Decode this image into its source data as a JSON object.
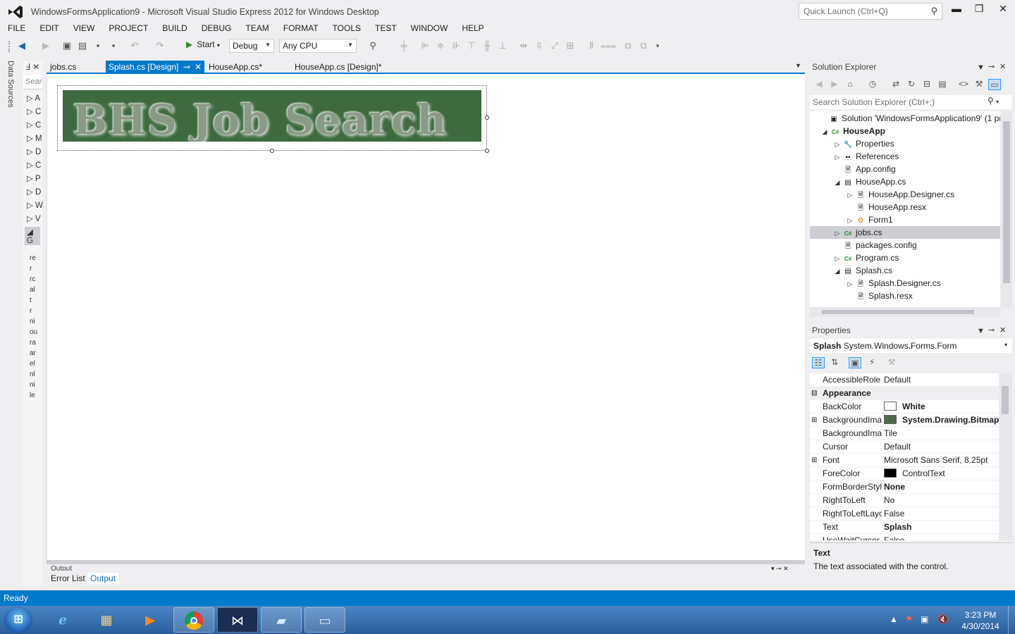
{
  "window": {
    "title": "WindowsFormsApplication9 - Microsoft Visual Studio Express 2012 for Windows Desktop",
    "quick_launch_placeholder": "Quick Launch (Ctrl+Q)",
    "minimize": "▬",
    "restore": "❐",
    "close": "✕"
  },
  "menu": [
    "FILE",
    "EDIT",
    "VIEW",
    "PROJECT",
    "BUILD",
    "DEBUG",
    "TEAM",
    "FORMAT",
    "TOOLS",
    "TEST",
    "WINDOW",
    "HELP"
  ],
  "toolbar": {
    "start_label": "Start",
    "config": "Debug",
    "platform": "Any CPU"
  },
  "left_panel": {
    "data_sources": "Data Sources",
    "toolbox_header": "Ⅎ",
    "toolbox_search": "Searc",
    "items": [
      "A",
      "C",
      "C",
      "M",
      "D",
      "C",
      "P",
      "D",
      "W",
      "V",
      "G"
    ],
    "fragments": [
      "re",
      "r",
      "rc",
      "al",
      "t",
      "r",
      "ni",
      "ou",
      "ra",
      "ar",
      "el",
      "nl",
      "ni",
      "le"
    ]
  },
  "tabs": [
    {
      "label": "jobs.cs"
    },
    {
      "label": "Splash.cs [Design]",
      "pin": "⊸",
      "close": "✕"
    },
    {
      "label": "HouseApp.cs*"
    },
    {
      "label": "HouseApp.cs [Design]*"
    }
  ],
  "designer": {
    "banner_text": "BHS Job Search",
    "banner_color": "#3e6a3f"
  },
  "output": {
    "title": "Output",
    "tabs": [
      "Error List",
      "Output"
    ]
  },
  "solution_explorer": {
    "title": "Solution Explorer",
    "search_placeholder": "Search Solution Explorer (Ctrl+;)",
    "nodes": [
      {
        "label": "Solution 'WindowsFormsApplication9' (1 pro",
        "expander": "",
        "icon": "▣"
      },
      {
        "label": "HouseApp",
        "expander": "◢",
        "icon": "C#",
        "bold": true
      },
      {
        "label": "Properties",
        "expander": "▷",
        "icon": "🔧"
      },
      {
        "label": "References",
        "expander": "▷",
        "icon": "▪▪"
      },
      {
        "label": "App.config",
        "expander": "",
        "icon": "🗎"
      },
      {
        "label": "HouseApp.cs",
        "expander": "◢",
        "icon": "▤"
      },
      {
        "label": "HouseApp.Designer.cs",
        "expander": "▷",
        "icon": "🗎"
      },
      {
        "label": "HouseApp.resx",
        "expander": "",
        "icon": "🗎"
      },
      {
        "label": "Form1",
        "expander": "▷",
        "icon": "⚙"
      },
      {
        "label": "jobs.cs",
        "expander": "▷",
        "icon": "C#"
      },
      {
        "label": "packages.config",
        "expander": "",
        "icon": "🗎"
      },
      {
        "label": "Program.cs",
        "expander": "▷",
        "icon": "C#"
      },
      {
        "label": "Splash.cs",
        "expander": "◢",
        "icon": "▤"
      },
      {
        "label": "Splash.Designer.cs",
        "expander": "▷",
        "icon": "🗎"
      },
      {
        "label": "Splash.resx",
        "expander": "",
        "icon": "🗎"
      }
    ]
  },
  "properties": {
    "title": "Properties",
    "object_name": "Splash",
    "object_type": "System.Windows.Forms.Form",
    "rows": [
      {
        "name": "AccessibleRole",
        "value": "Default"
      },
      {
        "name": "Appearance",
        "category": true,
        "exp": "⊟"
      },
      {
        "name": "BackColor",
        "value": "White",
        "swatch": "#ffffff",
        "bold": true
      },
      {
        "name": "BackgroundImage",
        "value": "System.Drawing.Bitmap",
        "swatch": "#4a6a4a",
        "bold": true,
        "exp": "⊞"
      },
      {
        "name": "BackgroundImageLayout",
        "value": "Tile"
      },
      {
        "name": "Cursor",
        "value": "Default"
      },
      {
        "name": "Font",
        "value": "Microsoft Sans Serif, 8.25pt",
        "exp": "⊞"
      },
      {
        "name": "ForeColor",
        "value": "ControlText",
        "swatch": "#000000"
      },
      {
        "name": "FormBorderStyle",
        "value": "None",
        "bold": true
      },
      {
        "name": "RightToLeft",
        "value": "No"
      },
      {
        "name": "RightToLeftLayout",
        "value": "False"
      },
      {
        "name": "Text",
        "value": "Splash",
        "bold": true
      },
      {
        "name": "UseWaitCursor",
        "value": "False"
      }
    ],
    "description_title": "Text",
    "description_text": "The text associated with the control."
  },
  "status": "Ready",
  "taskbar": {
    "time": "3:23 PM",
    "date": "4/30/2014"
  }
}
